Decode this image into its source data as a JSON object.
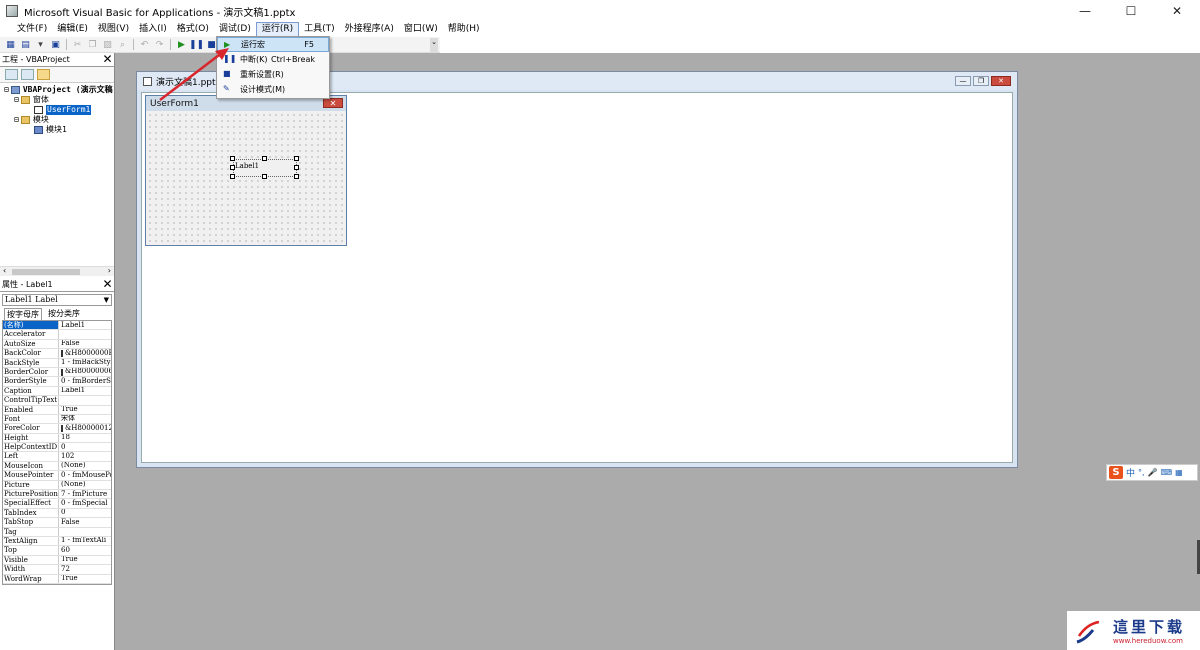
{
  "window": {
    "title": "Microsoft Visual Basic for Applications - 演示文稿1.pptx",
    "controls": {
      "minimize": "—",
      "maximize": "☐",
      "close": "✕"
    }
  },
  "menubar": {
    "items": [
      "文件(F)",
      "编辑(E)",
      "视图(V)",
      "插入(I)",
      "格式(O)",
      "调试(D)",
      "运行(R)",
      "工具(T)",
      "外接程序(A)",
      "窗口(W)",
      "帮助(H)"
    ],
    "active": "运行(R)"
  },
  "run_menu": {
    "items": [
      {
        "label": "运行宏",
        "shortcut": "F5",
        "icon": "play-icon"
      },
      {
        "label": "中断(K)",
        "shortcut": "Ctrl+Break",
        "icon": "pause-icon"
      },
      {
        "label": "重新设置(R)",
        "shortcut": "",
        "icon": "stop-icon"
      },
      {
        "label": "设计模式(M)",
        "shortcut": "",
        "icon": "design-mode-icon"
      }
    ]
  },
  "project_pane": {
    "title": "工程 - VBAProject",
    "tree": {
      "root": "VBAProject (演示文稿",
      "forms_folder": "窗体",
      "userform": "UserForm1",
      "modules_folder": "模块",
      "module": "模块1"
    }
  },
  "properties_pane": {
    "title": "属性 - Label1",
    "object_select": "Label1 Label",
    "tabs": [
      "按字母序",
      "按分类序"
    ],
    "rows": [
      {
        "name": "(名称)",
        "value": "Label1"
      },
      {
        "name": "Accelerator",
        "value": ""
      },
      {
        "name": "AutoSize",
        "value": "False"
      },
      {
        "name": "BackColor",
        "value": "&H8000000F&",
        "swatch": "#f0f0f0"
      },
      {
        "name": "BackStyle",
        "value": "1 - fmBackStyle"
      },
      {
        "name": "BorderColor",
        "value": "&H80000006&",
        "swatch": "#444444"
      },
      {
        "name": "BorderStyle",
        "value": "0 - fmBorderS"
      },
      {
        "name": "Caption",
        "value": "Label1"
      },
      {
        "name": "ControlTipText",
        "value": ""
      },
      {
        "name": "Enabled",
        "value": "True"
      },
      {
        "name": "Font",
        "value": "宋体"
      },
      {
        "name": "ForeColor",
        "value": "&H80000012&",
        "swatch": "#000000"
      },
      {
        "name": "Height",
        "value": "18"
      },
      {
        "name": "HelpContextID",
        "value": "0"
      },
      {
        "name": "Left",
        "value": "102"
      },
      {
        "name": "MouseIcon",
        "value": "(None)"
      },
      {
        "name": "MousePointer",
        "value": "0 - fmMousePo"
      },
      {
        "name": "Picture",
        "value": "(None)"
      },
      {
        "name": "PicturePosition",
        "value": "7 - fmPicture"
      },
      {
        "name": "SpecialEffect",
        "value": "0 - fmSpecial"
      },
      {
        "name": "TabIndex",
        "value": "0"
      },
      {
        "name": "TabStop",
        "value": "False"
      },
      {
        "name": "Tag",
        "value": ""
      },
      {
        "name": "TextAlign",
        "value": "1 - fmTextAli"
      },
      {
        "name": "Top",
        "value": "60"
      },
      {
        "name": "Visible",
        "value": "True"
      },
      {
        "name": "Width",
        "value": "72"
      },
      {
        "name": "WordWrap",
        "value": "True"
      }
    ]
  },
  "designer": {
    "window_title": "演示文稿1.pptx -",
    "userform_title": "UserForm1",
    "label_caption": "Label1"
  },
  "ime": {
    "lang": "中",
    "punct": "°,",
    "mic": "🎤",
    "keyboard": "⌨",
    "grid": "▦"
  },
  "watermark": {
    "name": "這里下载",
    "url": "www.hereduow.com"
  },
  "colors": {
    "accent": "#0a64c8",
    "workspace": "#ababab",
    "close_red": "#c94c3e",
    "arrow": "#d9262c"
  }
}
